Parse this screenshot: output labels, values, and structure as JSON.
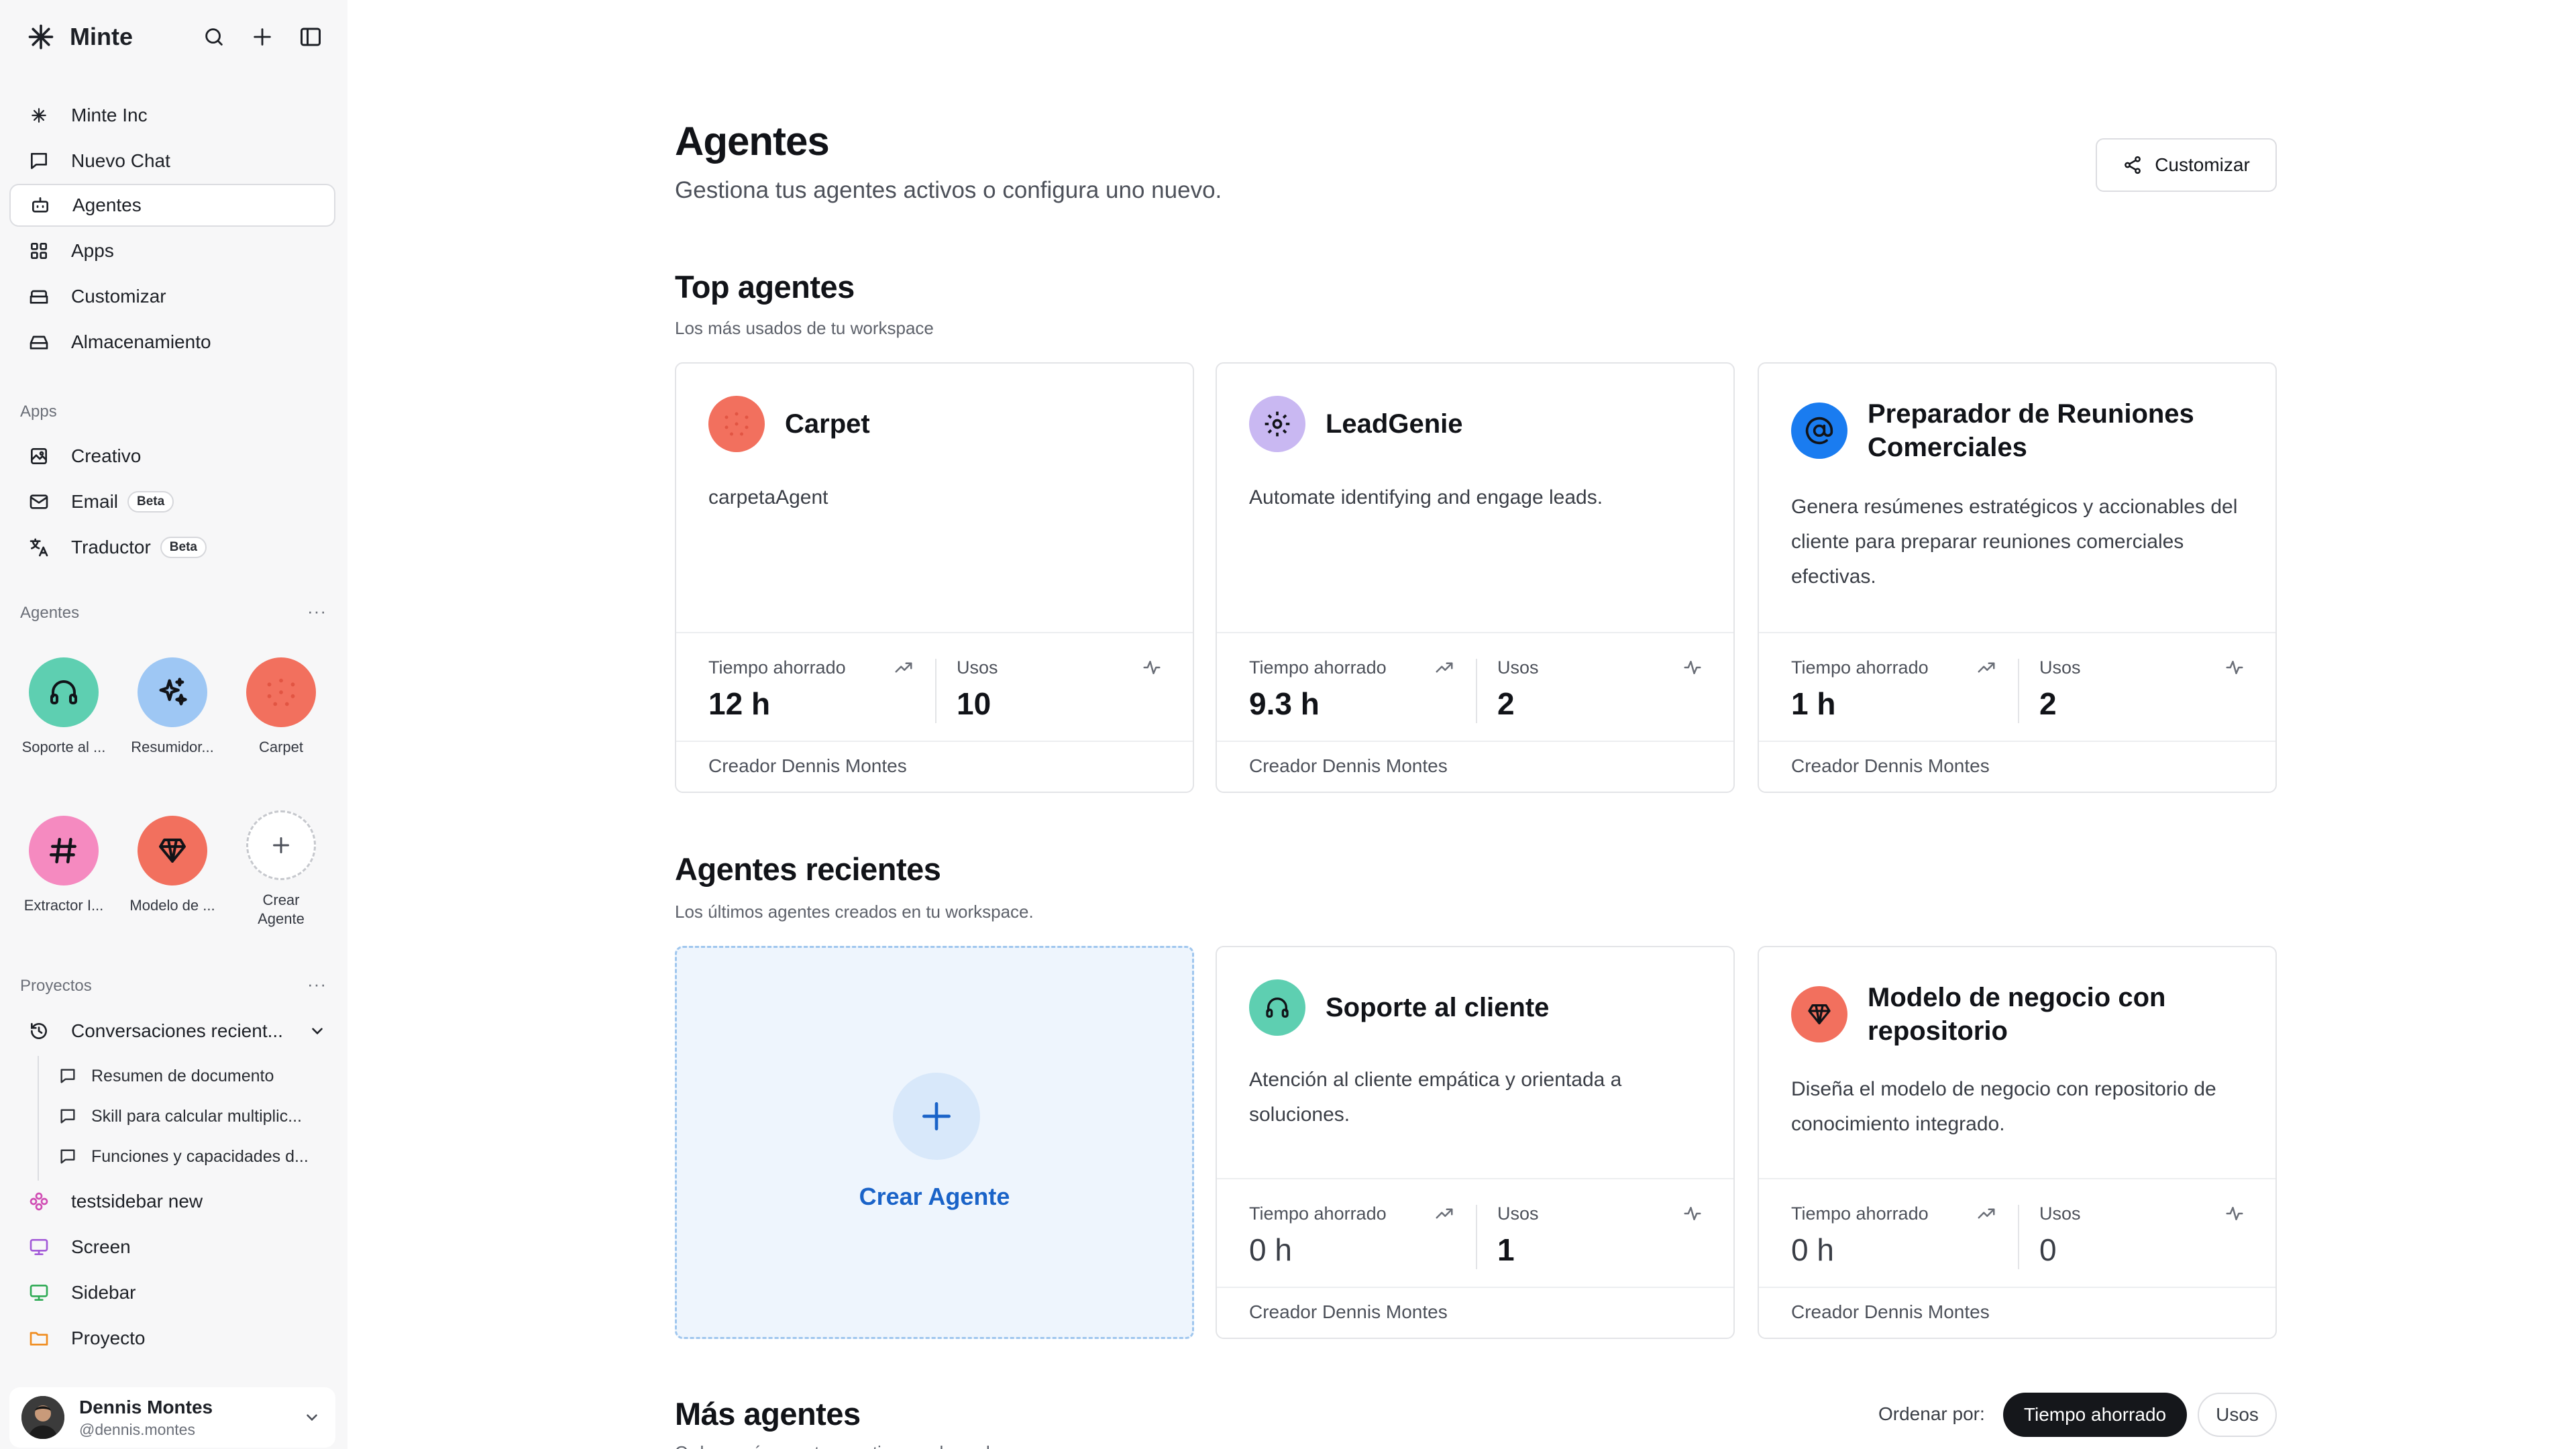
{
  "app": {
    "brand": "Minte"
  },
  "sidebar": {
    "nav": [
      {
        "label": "Minte Inc",
        "icon": "minte-logo-icon"
      },
      {
        "label": "Nuevo Chat",
        "icon": "chat-icon"
      },
      {
        "label": "Agentes",
        "icon": "bot-icon",
        "active": true
      },
      {
        "label": "Apps",
        "icon": "grid-icon"
      },
      {
        "label": "Customizar",
        "icon": "palette-icon"
      },
      {
        "label": "Almacenamiento",
        "icon": "storage-icon"
      }
    ],
    "apps_label": "Apps",
    "apps": [
      {
        "label": "Creativo",
        "icon": "image-sparkle-icon"
      },
      {
        "label": "Email",
        "icon": "mail-icon",
        "badge": "Beta"
      },
      {
        "label": "Traductor",
        "icon": "translate-icon",
        "badge": "Beta"
      }
    ],
    "agents_label": "Agentes",
    "more": "···",
    "agents": [
      {
        "name": "Soporte al ...",
        "color": "#5ecfb1",
        "icon": "headphones-icon"
      },
      {
        "name": "Resumidor...",
        "color": "#9ec7f4",
        "icon": "sparkles-icon"
      },
      {
        "name": "Carpet",
        "color": "#f2705e",
        "icon": "dots-icon"
      },
      {
        "name": "Extractor I...",
        "color": "#f58ac0",
        "icon": "hash-icon"
      },
      {
        "name": "Modelo de ...",
        "color": "#f2705e",
        "icon": "gem-icon"
      },
      {
        "name": "Crear\nAgente",
        "color": "#ffffff",
        "icon": "plus-icon"
      }
    ],
    "projects_label": "Proyectos",
    "projects": {
      "group": "Conversaciones recient...",
      "children": [
        "Resumen de documento",
        "Skill para calcular multiplic...",
        "Funciones y capacidades d..."
      ],
      "items": [
        {
          "label": "testsidebar new",
          "color": "#d04db4",
          "icon": "flower-icon"
        },
        {
          "label": "Screen",
          "color": "#a35ad8",
          "icon": "monitor-icon"
        },
        {
          "label": "Sidebar",
          "color": "#2faa55",
          "icon": "monitor-icon"
        },
        {
          "label": "Proyecto",
          "color": "#f08c1e",
          "icon": "folder-icon"
        }
      ]
    },
    "user": {
      "name": "Dennis Montes",
      "handle": "@dennis.montes"
    }
  },
  "main": {
    "title": "Agentes",
    "subtitle": "Gestiona tus agentes activos o configura uno nuevo.",
    "customize_button": "Customizar",
    "top": {
      "title": "Top agentes",
      "subtitle": "Los más usados de tu workspace",
      "cards": [
        {
          "name": "Carpet",
          "desc": "carpetaAgent",
          "color": "#f2705e",
          "icon": "dots-icon",
          "time_label": "Tiempo ahorrado",
          "time": "12 h",
          "uses_label": "Usos",
          "uses": "10",
          "creator": "Creador Dennis Montes"
        },
        {
          "name": "LeadGenie",
          "desc": "Automate identifying and engage leads.",
          "color": "#c9b8f2",
          "icon": "gear-icon",
          "time_label": "Tiempo ahorrado",
          "time": "9.3 h",
          "uses_label": "Usos",
          "uses": "2",
          "creator": "Creador Dennis Montes"
        },
        {
          "name": "Preparador de Reuniones Comerciales",
          "desc": "Genera resúmenes estratégicos y accionables del cliente para preparar reuniones comerciales efectivas.",
          "color": "#1a7cf0",
          "icon": "at-icon",
          "time_label": "Tiempo ahorrado",
          "time": "1 h",
          "uses_label": "Usos",
          "uses": "2",
          "creator": "Creador Dennis Montes"
        }
      ]
    },
    "recent": {
      "title": "Agentes recientes",
      "subtitle": "Los últimos agentes creados en tu workspace.",
      "create_label": "Crear Agente",
      "cards": [
        {
          "name": "Soporte al cliente",
          "desc": "Atención al cliente empática y orientada a soluciones.",
          "color": "#5ecfb1",
          "icon": "headphones-icon",
          "time_label": "Tiempo ahorrado",
          "time": "0 h",
          "uses_label": "Usos",
          "uses": "1",
          "creator": "Creador Dennis Montes"
        },
        {
          "name": "Modelo de negocio con repositorio",
          "desc": "Diseña el modelo de negocio con repositorio de conocimiento integrado.",
          "color": "#f2705e",
          "icon": "gem-icon",
          "time_label": "Tiempo ahorrado",
          "time": "0 h",
          "uses_label": "Usos",
          "uses": "0",
          "creator": "Creador Dennis Montes"
        }
      ]
    },
    "more": {
      "title": "Más agentes",
      "subtitle": "Ordena más agentes por tiempo ahorrado o usos.",
      "sort_label": "Ordenar por:",
      "sort_options": [
        "Tiempo ahorrado",
        "Usos"
      ]
    }
  }
}
